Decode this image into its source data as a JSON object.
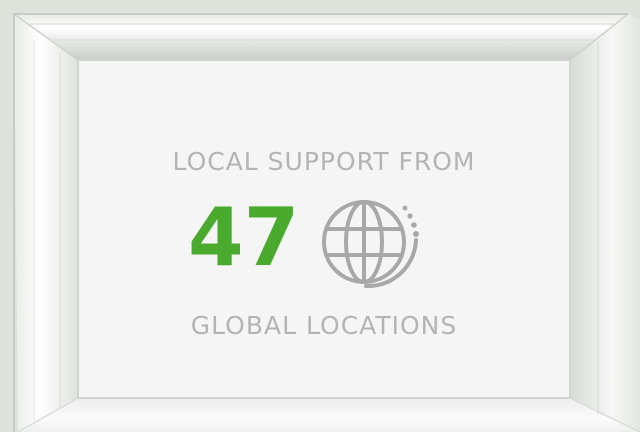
{
  "promo": {
    "line1": "LOCAL SUPPORT FROM",
    "count": "47",
    "line2": "GLOBAL LOCATIONS",
    "icon": "globe-icon"
  },
  "colors": {
    "accent": "#4aaa2e",
    "text": "#b4b4b4",
    "icon": "#a8a8a8",
    "background": "#dde3db",
    "frame": "#f2f3f2",
    "panel": "#f5f5f5"
  }
}
